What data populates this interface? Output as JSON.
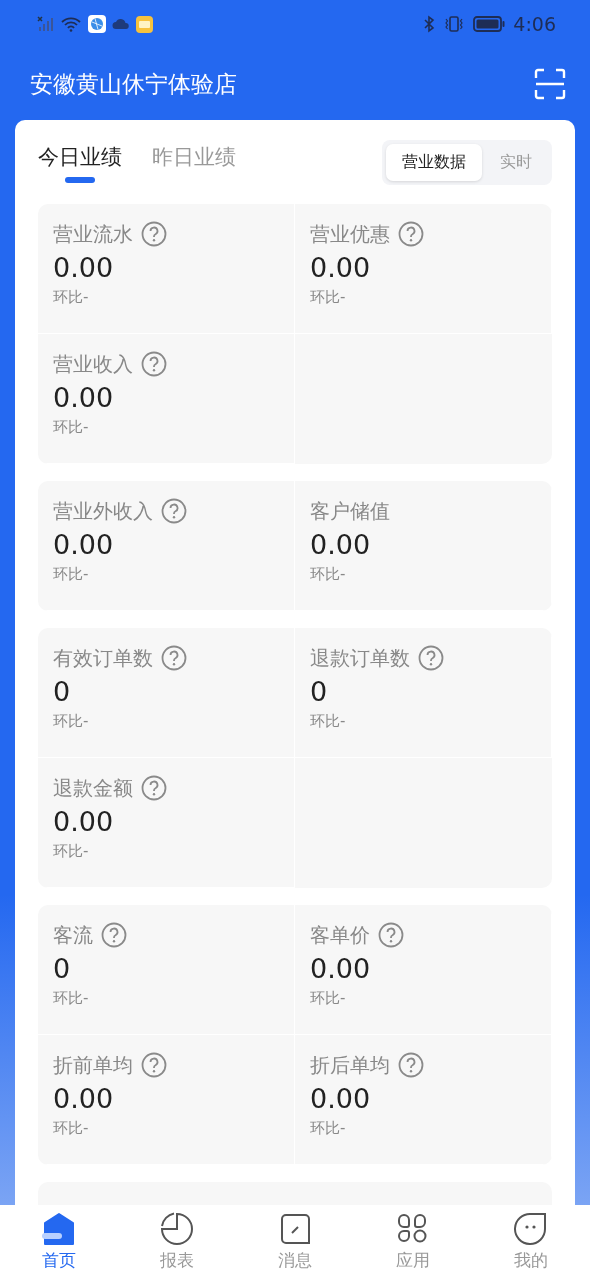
{
  "status_bar": {
    "time": "4:06"
  },
  "header": {
    "title": "安徽黄山休宁体验店"
  },
  "tabs": [
    {
      "label": "今日业绩",
      "selected": true
    },
    {
      "label": "昨日业绩",
      "selected": false
    }
  ],
  "segment": [
    {
      "label": "营业数据",
      "selected": true
    },
    {
      "label": "实时",
      "selected": false
    }
  ],
  "groups": [
    {
      "metrics": [
        {
          "label": "营业流水",
          "help": true,
          "value": "0.00",
          "compare": "环比-"
        },
        {
          "label": "营业优惠",
          "help": true,
          "value": "0.00",
          "compare": "环比-"
        },
        {
          "label": "营业收入",
          "help": true,
          "value": "0.00",
          "compare": "环比-"
        }
      ]
    },
    {
      "metrics": [
        {
          "label": "营业外收入",
          "help": true,
          "value": "0.00",
          "compare": "环比-"
        },
        {
          "label": "客户储值",
          "help": false,
          "value": "0.00",
          "compare": "环比-"
        }
      ]
    },
    {
      "metrics": [
        {
          "label": "有效订单数",
          "help": true,
          "value": "0",
          "compare": "环比-"
        },
        {
          "label": "退款订单数",
          "help": true,
          "value": "0",
          "compare": "环比-"
        },
        {
          "label": "退款金额",
          "help": true,
          "value": "0.00",
          "compare": "环比-"
        }
      ]
    },
    {
      "metrics": [
        {
          "label": "客流",
          "help": true,
          "value": "0",
          "compare": "环比-"
        },
        {
          "label": "客单价",
          "help": true,
          "value": "0.00",
          "compare": "环比-"
        },
        {
          "label": "折前单均",
          "help": true,
          "value": "0.00",
          "compare": "环比-"
        },
        {
          "label": "折后单均",
          "help": true,
          "value": "0.00",
          "compare": "环比-"
        }
      ]
    }
  ],
  "nav": [
    {
      "label": "首页",
      "kind": "home",
      "selected": true
    },
    {
      "label": "报表",
      "kind": "report",
      "selected": false
    },
    {
      "label": "消息",
      "kind": "message",
      "selected": false
    },
    {
      "label": "应用",
      "kind": "apps",
      "selected": false
    },
    {
      "label": "我的",
      "kind": "me",
      "selected": false
    }
  ]
}
